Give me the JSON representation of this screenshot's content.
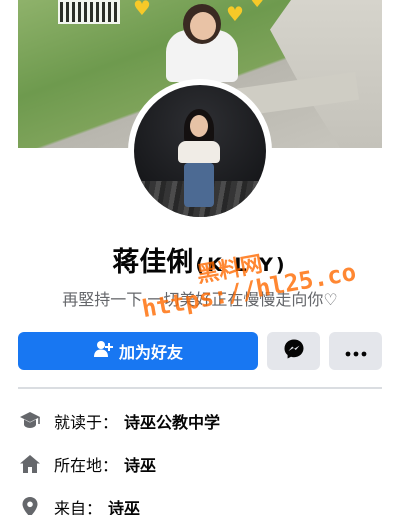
{
  "profile": {
    "name": "蒋佳俐",
    "name_suffix": "(K L Y)",
    "bio": "再堅持一下 一切美好正在慢慢走向你♡"
  },
  "watermark": {
    "title": "黑料网",
    "url": "https://hl25.co"
  },
  "actions": {
    "add_friend_label": "加为好友",
    "messenger_icon": "messenger-icon",
    "more_icon": "more-dots-icon"
  },
  "info": {
    "items": [
      {
        "label": "就读于：",
        "value": "诗巫公教中学",
        "icon": "education-cap-icon"
      },
      {
        "label": "所在地：",
        "value": "诗巫",
        "icon": "home-icon"
      },
      {
        "label": "来自：",
        "value": "诗巫",
        "icon": "location-pin-icon"
      }
    ]
  },
  "colors": {
    "primary": "#1877f2",
    "secondary_button": "#e4e6eb",
    "text": "#050505",
    "muted_text": "#65676b",
    "watermark": "#ff6a00",
    "divider": "#dadde1"
  }
}
